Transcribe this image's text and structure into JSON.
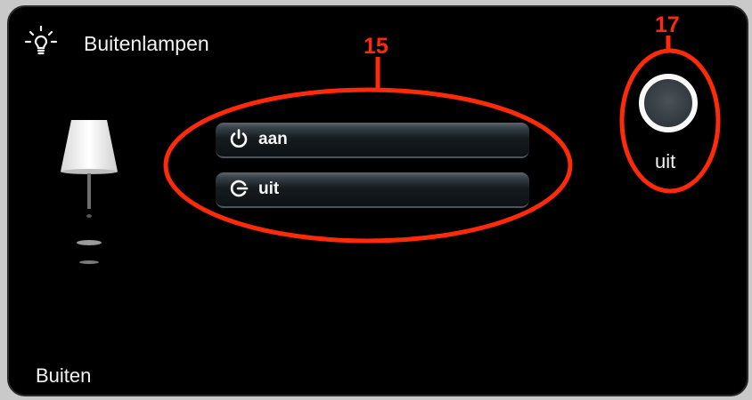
{
  "header": {
    "title": "Buitenlampen",
    "icon": "lightbulb-icon"
  },
  "buttons": [
    {
      "label": "aan",
      "icon": "power-icon"
    },
    {
      "label": "uit",
      "icon": "power-off-icon"
    }
  ],
  "status": {
    "label": "uit",
    "state": "off"
  },
  "footer": {
    "label": "Buiten"
  },
  "annotations": {
    "n15": "15",
    "n17": "17",
    "color": "#ff2a0a"
  }
}
